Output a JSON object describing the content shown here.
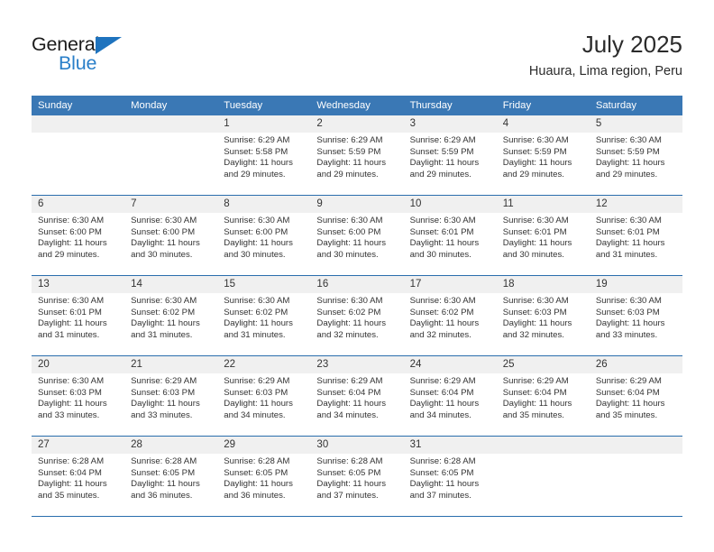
{
  "logo": {
    "word_top": "General",
    "word_bottom": "Blue",
    "triangle_color": "#1e73be",
    "blue_text_color": "#2a7fc9"
  },
  "header": {
    "title": "July 2025",
    "subtitle": "Huaura, Lima region, Peru"
  },
  "theme": {
    "header_row_bg": "#3a78b5",
    "week_divider": "#2a6ead",
    "daynum_bg": "#f0f0f0",
    "text": "#333333"
  },
  "weekday_headers": [
    "Sunday",
    "Monday",
    "Tuesday",
    "Wednesday",
    "Thursday",
    "Friday",
    "Saturday"
  ],
  "labels": {
    "sunrise_prefix": "Sunrise: ",
    "sunset_prefix": "Sunset: ",
    "daylight_prefix": "Daylight: "
  },
  "weeks": [
    {
      "days": [
        {
          "date": "",
          "empty": true
        },
        {
          "date": "",
          "empty": true
        },
        {
          "date": "1",
          "sunrise": "Sunrise: 6:29 AM",
          "sunset": "Sunset: 5:58 PM",
          "daylight_line1": "Daylight: 11 hours",
          "daylight_line2": "and 29 minutes."
        },
        {
          "date": "2",
          "sunrise": "Sunrise: 6:29 AM",
          "sunset": "Sunset: 5:59 PM",
          "daylight_line1": "Daylight: 11 hours",
          "daylight_line2": "and 29 minutes."
        },
        {
          "date": "3",
          "sunrise": "Sunrise: 6:29 AM",
          "sunset": "Sunset: 5:59 PM",
          "daylight_line1": "Daylight: 11 hours",
          "daylight_line2": "and 29 minutes."
        },
        {
          "date": "4",
          "sunrise": "Sunrise: 6:30 AM",
          "sunset": "Sunset: 5:59 PM",
          "daylight_line1": "Daylight: 11 hours",
          "daylight_line2": "and 29 minutes."
        },
        {
          "date": "5",
          "sunrise": "Sunrise: 6:30 AM",
          "sunset": "Sunset: 5:59 PM",
          "daylight_line1": "Daylight: 11 hours",
          "daylight_line2": "and 29 minutes."
        }
      ]
    },
    {
      "days": [
        {
          "date": "6",
          "sunrise": "Sunrise: 6:30 AM",
          "sunset": "Sunset: 6:00 PM",
          "daylight_line1": "Daylight: 11 hours",
          "daylight_line2": "and 29 minutes."
        },
        {
          "date": "7",
          "sunrise": "Sunrise: 6:30 AM",
          "sunset": "Sunset: 6:00 PM",
          "daylight_line1": "Daylight: 11 hours",
          "daylight_line2": "and 30 minutes."
        },
        {
          "date": "8",
          "sunrise": "Sunrise: 6:30 AM",
          "sunset": "Sunset: 6:00 PM",
          "daylight_line1": "Daylight: 11 hours",
          "daylight_line2": "and 30 minutes."
        },
        {
          "date": "9",
          "sunrise": "Sunrise: 6:30 AM",
          "sunset": "Sunset: 6:00 PM",
          "daylight_line1": "Daylight: 11 hours",
          "daylight_line2": "and 30 minutes."
        },
        {
          "date": "10",
          "sunrise": "Sunrise: 6:30 AM",
          "sunset": "Sunset: 6:01 PM",
          "daylight_line1": "Daylight: 11 hours",
          "daylight_line2": "and 30 minutes."
        },
        {
          "date": "11",
          "sunrise": "Sunrise: 6:30 AM",
          "sunset": "Sunset: 6:01 PM",
          "daylight_line1": "Daylight: 11 hours",
          "daylight_line2": "and 30 minutes."
        },
        {
          "date": "12",
          "sunrise": "Sunrise: 6:30 AM",
          "sunset": "Sunset: 6:01 PM",
          "daylight_line1": "Daylight: 11 hours",
          "daylight_line2": "and 31 minutes."
        }
      ]
    },
    {
      "days": [
        {
          "date": "13",
          "sunrise": "Sunrise: 6:30 AM",
          "sunset": "Sunset: 6:01 PM",
          "daylight_line1": "Daylight: 11 hours",
          "daylight_line2": "and 31 minutes."
        },
        {
          "date": "14",
          "sunrise": "Sunrise: 6:30 AM",
          "sunset": "Sunset: 6:02 PM",
          "daylight_line1": "Daylight: 11 hours",
          "daylight_line2": "and 31 minutes."
        },
        {
          "date": "15",
          "sunrise": "Sunrise: 6:30 AM",
          "sunset": "Sunset: 6:02 PM",
          "daylight_line1": "Daylight: 11 hours",
          "daylight_line2": "and 31 minutes."
        },
        {
          "date": "16",
          "sunrise": "Sunrise: 6:30 AM",
          "sunset": "Sunset: 6:02 PM",
          "daylight_line1": "Daylight: 11 hours",
          "daylight_line2": "and 32 minutes."
        },
        {
          "date": "17",
          "sunrise": "Sunrise: 6:30 AM",
          "sunset": "Sunset: 6:02 PM",
          "daylight_line1": "Daylight: 11 hours",
          "daylight_line2": "and 32 minutes."
        },
        {
          "date": "18",
          "sunrise": "Sunrise: 6:30 AM",
          "sunset": "Sunset: 6:03 PM",
          "daylight_line1": "Daylight: 11 hours",
          "daylight_line2": "and 32 minutes."
        },
        {
          "date": "19",
          "sunrise": "Sunrise: 6:30 AM",
          "sunset": "Sunset: 6:03 PM",
          "daylight_line1": "Daylight: 11 hours",
          "daylight_line2": "and 33 minutes."
        }
      ]
    },
    {
      "days": [
        {
          "date": "20",
          "sunrise": "Sunrise: 6:30 AM",
          "sunset": "Sunset: 6:03 PM",
          "daylight_line1": "Daylight: 11 hours",
          "daylight_line2": "and 33 minutes."
        },
        {
          "date": "21",
          "sunrise": "Sunrise: 6:29 AM",
          "sunset": "Sunset: 6:03 PM",
          "daylight_line1": "Daylight: 11 hours",
          "daylight_line2": "and 33 minutes."
        },
        {
          "date": "22",
          "sunrise": "Sunrise: 6:29 AM",
          "sunset": "Sunset: 6:03 PM",
          "daylight_line1": "Daylight: 11 hours",
          "daylight_line2": "and 34 minutes."
        },
        {
          "date": "23",
          "sunrise": "Sunrise: 6:29 AM",
          "sunset": "Sunset: 6:04 PM",
          "daylight_line1": "Daylight: 11 hours",
          "daylight_line2": "and 34 minutes."
        },
        {
          "date": "24",
          "sunrise": "Sunrise: 6:29 AM",
          "sunset": "Sunset: 6:04 PM",
          "daylight_line1": "Daylight: 11 hours",
          "daylight_line2": "and 34 minutes."
        },
        {
          "date": "25",
          "sunrise": "Sunrise: 6:29 AM",
          "sunset": "Sunset: 6:04 PM",
          "daylight_line1": "Daylight: 11 hours",
          "daylight_line2": "and 35 minutes."
        },
        {
          "date": "26",
          "sunrise": "Sunrise: 6:29 AM",
          "sunset": "Sunset: 6:04 PM",
          "daylight_line1": "Daylight: 11 hours",
          "daylight_line2": "and 35 minutes."
        }
      ]
    },
    {
      "days": [
        {
          "date": "27",
          "sunrise": "Sunrise: 6:28 AM",
          "sunset": "Sunset: 6:04 PM",
          "daylight_line1": "Daylight: 11 hours",
          "daylight_line2": "and 35 minutes."
        },
        {
          "date": "28",
          "sunrise": "Sunrise: 6:28 AM",
          "sunset": "Sunset: 6:05 PM",
          "daylight_line1": "Daylight: 11 hours",
          "daylight_line2": "and 36 minutes."
        },
        {
          "date": "29",
          "sunrise": "Sunrise: 6:28 AM",
          "sunset": "Sunset: 6:05 PM",
          "daylight_line1": "Daylight: 11 hours",
          "daylight_line2": "and 36 minutes."
        },
        {
          "date": "30",
          "sunrise": "Sunrise: 6:28 AM",
          "sunset": "Sunset: 6:05 PM",
          "daylight_line1": "Daylight: 11 hours",
          "daylight_line2": "and 37 minutes."
        },
        {
          "date": "31",
          "sunrise": "Sunrise: 6:28 AM",
          "sunset": "Sunset: 6:05 PM",
          "daylight_line1": "Daylight: 11 hours",
          "daylight_line2": "and 37 minutes."
        },
        {
          "date": "",
          "empty": true
        },
        {
          "date": "",
          "empty": true
        }
      ]
    }
  ]
}
